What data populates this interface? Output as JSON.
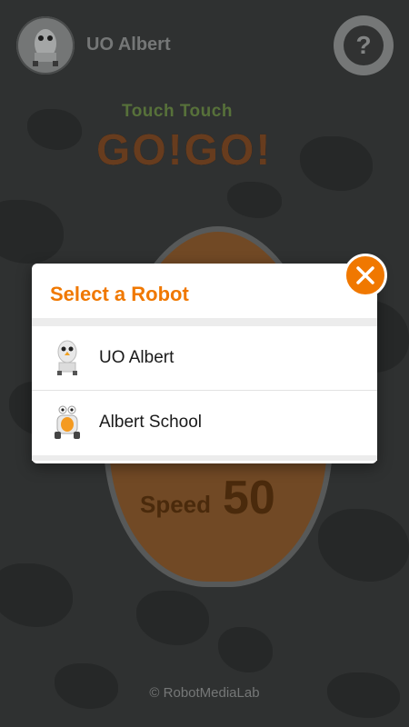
{
  "header": {
    "robot_name": "UO Albert",
    "help_symbol": "?"
  },
  "logo": {
    "line1": "Touch Touch",
    "line2": "GO!GO!"
  },
  "speed": {
    "label": "Speed",
    "value": "50"
  },
  "footer": {
    "copyright": "© RobotMediaLab"
  },
  "dialog": {
    "title": "Select a Robot",
    "items": [
      {
        "label": "UO Albert",
        "icon": "uo-albert-robot-icon"
      },
      {
        "label": "Albert School",
        "icon": "albert-school-robot-icon"
      }
    ]
  },
  "colors": {
    "accent": "#f07800",
    "background": "#3a3c3c"
  }
}
